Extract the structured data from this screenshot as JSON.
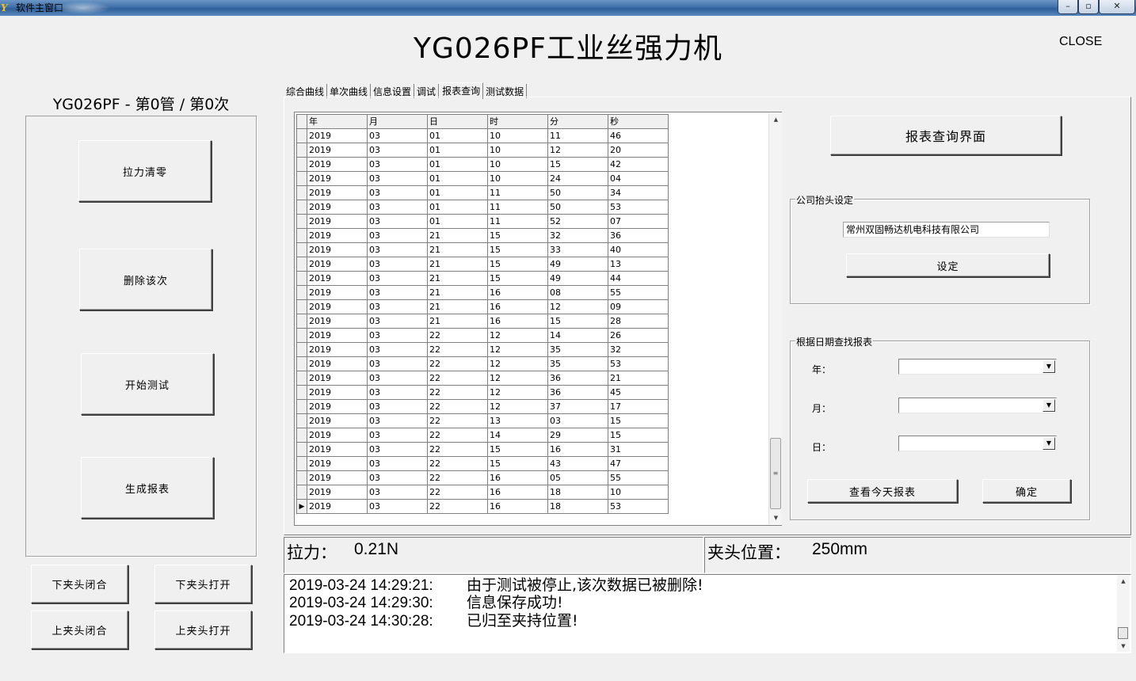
{
  "window": {
    "title": "软件主窗口",
    "app_icon_text": "Y",
    "minimize": "–",
    "maximize": "▫",
    "close": "✕"
  },
  "header": {
    "title": "YG026PF工业丝强力机",
    "close_link": "CLOSE"
  },
  "left": {
    "title": "YG026PF - 第0管 / 第0次",
    "buttons": {
      "zero": "拉力清零",
      "delete": "删除该次",
      "start": "开始测试",
      "report": "生成报表",
      "lower_close": "下夹头闭合",
      "lower_open": "下夹头打开",
      "upper_close": "上夹头闭合",
      "upper_open": "上夹头打开"
    }
  },
  "tabs": [
    "综合曲线",
    "单次曲线",
    "信息设置",
    "调试",
    "报表查询",
    "测试数据"
  ],
  "active_tab": 4,
  "grid": {
    "columns": [
      "年",
      "月",
      "日",
      "时",
      "分",
      "秒"
    ],
    "rows": [
      [
        "2019",
        "03",
        "01",
        "10",
        "11",
        "46"
      ],
      [
        "2019",
        "03",
        "01",
        "10",
        "12",
        "20"
      ],
      [
        "2019",
        "03",
        "01",
        "10",
        "15",
        "42"
      ],
      [
        "2019",
        "03",
        "01",
        "10",
        "24",
        "04"
      ],
      [
        "2019",
        "03",
        "01",
        "11",
        "50",
        "34"
      ],
      [
        "2019",
        "03",
        "01",
        "11",
        "50",
        "53"
      ],
      [
        "2019",
        "03",
        "01",
        "11",
        "52",
        "07"
      ],
      [
        "2019",
        "03",
        "21",
        "15",
        "32",
        "36"
      ],
      [
        "2019",
        "03",
        "21",
        "15",
        "33",
        "40"
      ],
      [
        "2019",
        "03",
        "21",
        "15",
        "49",
        "13"
      ],
      [
        "2019",
        "03",
        "21",
        "15",
        "49",
        "44"
      ],
      [
        "2019",
        "03",
        "21",
        "16",
        "08",
        "55"
      ],
      [
        "2019",
        "03",
        "21",
        "16",
        "12",
        "09"
      ],
      [
        "2019",
        "03",
        "21",
        "16",
        "15",
        "28"
      ],
      [
        "2019",
        "03",
        "22",
        "12",
        "14",
        "26"
      ],
      [
        "2019",
        "03",
        "22",
        "12",
        "35",
        "32"
      ],
      [
        "2019",
        "03",
        "22",
        "12",
        "35",
        "53"
      ],
      [
        "2019",
        "03",
        "22",
        "12",
        "36",
        "21"
      ],
      [
        "2019",
        "03",
        "22",
        "12",
        "36",
        "45"
      ],
      [
        "2019",
        "03",
        "22",
        "12",
        "37",
        "17"
      ],
      [
        "2019",
        "03",
        "22",
        "13",
        "03",
        "15"
      ],
      [
        "2019",
        "03",
        "22",
        "14",
        "29",
        "15"
      ],
      [
        "2019",
        "03",
        "22",
        "15",
        "16",
        "31"
      ],
      [
        "2019",
        "03",
        "22",
        "15",
        "43",
        "47"
      ],
      [
        "2019",
        "03",
        "22",
        "16",
        "05",
        "55"
      ],
      [
        "2019",
        "03",
        "22",
        "16",
        "18",
        "10"
      ],
      [
        "2019",
        "03",
        "22",
        "16",
        "18",
        "53"
      ]
    ],
    "current_row_marker": "▶"
  },
  "report_panel": {
    "title_button": "报表查询界面",
    "company_group": "公司抬头设定",
    "company_value": "常州双固畅达机电科技有限公司",
    "set_button": "设定",
    "date_group": "根据日期查找报表",
    "year_label": "年：",
    "month_label": "月：",
    "day_label": "日：",
    "year_value": "",
    "month_value": "",
    "day_value": "",
    "today_button": "查看今天报表",
    "ok_button": "确定"
  },
  "status": {
    "force_label": "拉力：",
    "force_value": "0.21N",
    "clamp_label": "夹头位置：",
    "clamp_value": "250mm"
  },
  "log": [
    {
      "time": "2019-03-24 14:29:21:",
      "msg": "由于测试被停止,该次数据已被删除!"
    },
    {
      "time": "2019-03-24 14:29:30:",
      "msg": "信息保存成功!"
    },
    {
      "time": "2019-03-24 14:30:28:",
      "msg": "已归至夹持位置!"
    }
  ]
}
